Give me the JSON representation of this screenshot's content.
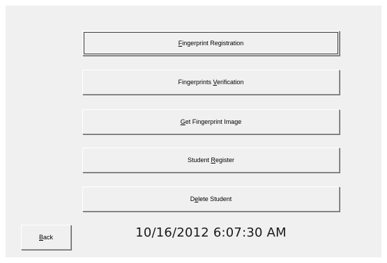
{
  "buttons": [
    {
      "id": "fingerprint-registration-button",
      "pre": "",
      "key": "F",
      "post": "ingerprint Registration",
      "label": "Fingerprint Registration",
      "default": true
    },
    {
      "id": "fingerprints-verification-button",
      "pre": "Fingerprints ",
      "key": "V",
      "post": "erification",
      "label": "Fingerprints Verification",
      "default": false
    },
    {
      "id": "get-fingerprint-image-button",
      "pre": "",
      "key": "G",
      "post": "et Fingerprint Image",
      "label": "Get Fingerprint Image",
      "default": false
    },
    {
      "id": "student-register-button",
      "pre": "Student ",
      "key": "R",
      "post": "egister",
      "label": "Student Register",
      "default": false
    },
    {
      "id": "delete-student-button",
      "pre": "D",
      "key": "e",
      "post": "lete Student",
      "label": "Delete Student",
      "default": false
    }
  ],
  "back": {
    "pre": "",
    "key": "B",
    "post": "ack",
    "label": "Back"
  },
  "datetime": "10/16/2012 6:07:30 AM"
}
